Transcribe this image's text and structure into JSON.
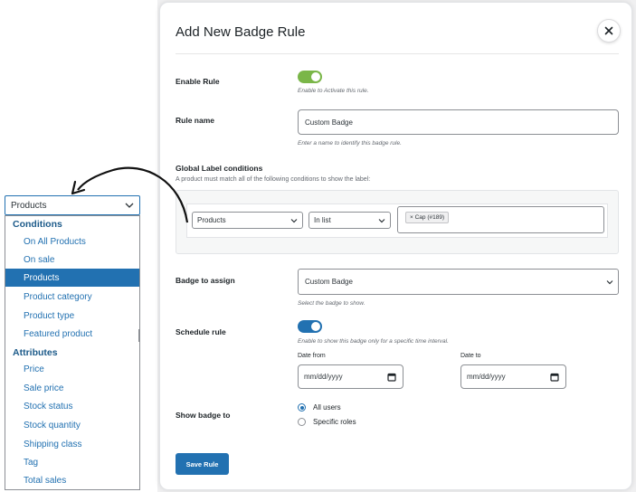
{
  "modal": {
    "title": "Add New Badge Rule",
    "close_icon": "close-icon",
    "enable_rule": {
      "label": "Enable Rule",
      "help": "Enable to Activate this rule.",
      "on": true,
      "color": "#7ab648"
    },
    "rule_name": {
      "label": "Rule name",
      "value": "Custom Badge",
      "help": "Enter a name to identify this badge rule."
    },
    "global_conditions": {
      "label": "Global Label conditions",
      "description": "A product must match all of the following conditions to show the label:",
      "condition_type": "Products",
      "operator": "In list",
      "chip": "× Cap (#189)"
    },
    "badge_to_assign": {
      "label": "Badge to assign",
      "value": "Custom Badge",
      "help": "Select the badge to show."
    },
    "schedule_rule": {
      "label": "Schedule rule",
      "help": "Enable to show this badge only for a specific time interval.",
      "on": true,
      "color": "#2271b1",
      "date_from_label": "Date from",
      "date_to_label": "Date to",
      "date_placeholder": "mm/dd/yyyy"
    },
    "show_badge_to": {
      "label": "Show badge to",
      "options": [
        "All users",
        "Specific roles"
      ],
      "selected": "All users"
    },
    "save_label": "Save Rule",
    "accent_color": "#2271b1"
  },
  "dropdown": {
    "value": "Products",
    "groups": [
      {
        "name": "Conditions",
        "items": [
          "On All Products",
          "On sale",
          "Products",
          "Product category",
          "Product type",
          "Featured product"
        ]
      },
      {
        "name": "Attributes",
        "items": [
          "Price",
          "Sale price",
          "Stock status",
          "Stock quantity",
          "Shipping class",
          "Tag",
          "Total sales"
        ]
      }
    ],
    "selected": "Products"
  }
}
